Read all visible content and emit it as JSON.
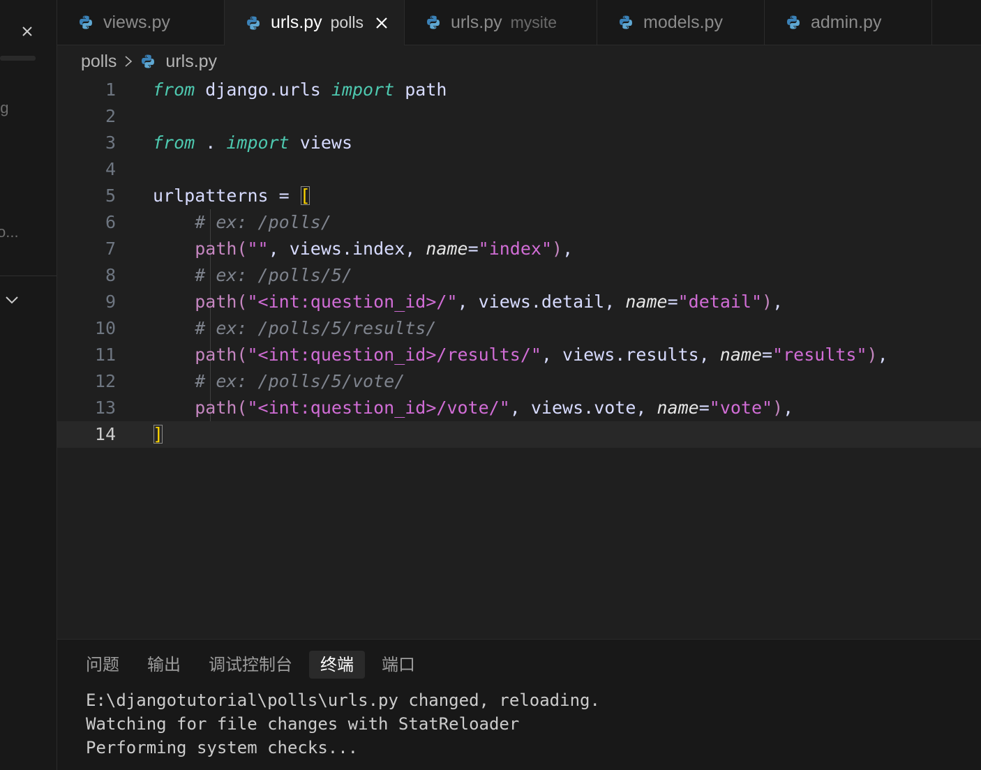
{
  "side_panel": {
    "fragment_1": "ng",
    "fragment_2": "o..."
  },
  "tabs": [
    {
      "label": "views.py",
      "description": "",
      "active": false
    },
    {
      "label": "urls.py",
      "description": "polls",
      "active": true
    },
    {
      "label": "urls.py",
      "description": "mysite",
      "active": false
    },
    {
      "label": "models.py",
      "description": "",
      "active": false
    },
    {
      "label": "admin.py",
      "description": "",
      "active": false
    }
  ],
  "breadcrumb": {
    "folder": "polls",
    "file": "urls.py"
  },
  "editor": {
    "current_line": 14,
    "line_numbers": [
      "1",
      "2",
      "3",
      "4",
      "5",
      "6",
      "7",
      "8",
      "9",
      "10",
      "11",
      "12",
      "13",
      "14"
    ],
    "lines": [
      [
        {
          "t": "from",
          "c": "kw"
        },
        {
          "t": " django.urls ",
          "c": "def"
        },
        {
          "t": "import",
          "c": "kw"
        },
        {
          "t": " path",
          "c": "def"
        }
      ],
      [],
      [
        {
          "t": "from",
          "c": "kw"
        },
        {
          "t": " . ",
          "c": "def"
        },
        {
          "t": "import",
          "c": "kw"
        },
        {
          "t": " views",
          "c": "def"
        }
      ],
      [],
      [
        {
          "t": "urlpatterns = ",
          "c": "def"
        },
        {
          "t": "[",
          "c": "br"
        }
      ],
      [
        {
          "t": "    "
        },
        {
          "t": "# ex: /polls/",
          "c": "cm"
        }
      ],
      [
        {
          "t": "    "
        },
        {
          "t": "path(",
          "c": "pw"
        },
        {
          "t": "\"\"",
          "c": "st"
        },
        {
          "t": ", views.index, ",
          "c": "def"
        },
        {
          "t": "name",
          "c": "pm"
        },
        {
          "t": "=",
          "c": "def"
        },
        {
          "t": "\"index\"",
          "c": "st"
        },
        {
          "t": ")",
          "c": "pw"
        },
        {
          "t": ",",
          "c": "def"
        }
      ],
      [
        {
          "t": "    "
        },
        {
          "t": "# ex: /polls/5/",
          "c": "cm"
        }
      ],
      [
        {
          "t": "    "
        },
        {
          "t": "path(",
          "c": "pw"
        },
        {
          "t": "\"<int:question_id>/\"",
          "c": "st"
        },
        {
          "t": ", views.detail, ",
          "c": "def"
        },
        {
          "t": "name",
          "c": "pm"
        },
        {
          "t": "=",
          "c": "def"
        },
        {
          "t": "\"detail\"",
          "c": "st"
        },
        {
          "t": ")",
          "c": "pw"
        },
        {
          "t": ",",
          "c": "def"
        }
      ],
      [
        {
          "t": "    "
        },
        {
          "t": "# ex: /polls/5/results/",
          "c": "cm"
        }
      ],
      [
        {
          "t": "    "
        },
        {
          "t": "path(",
          "c": "pw"
        },
        {
          "t": "\"<int:question_id>/results/\"",
          "c": "st"
        },
        {
          "t": ", views.results, ",
          "c": "def"
        },
        {
          "t": "name",
          "c": "pm"
        },
        {
          "t": "=",
          "c": "def"
        },
        {
          "t": "\"results\"",
          "c": "st"
        },
        {
          "t": ")",
          "c": "pw"
        },
        {
          "t": ",",
          "c": "def"
        }
      ],
      [
        {
          "t": "    "
        },
        {
          "t": "# ex: /polls/5/vote/",
          "c": "cm"
        }
      ],
      [
        {
          "t": "    "
        },
        {
          "t": "path(",
          "c": "pw"
        },
        {
          "t": "\"<int:question_id>/vote/\"",
          "c": "st"
        },
        {
          "t": ", views.vote, ",
          "c": "def"
        },
        {
          "t": "name",
          "c": "pm"
        },
        {
          "t": "=",
          "c": "def"
        },
        {
          "t": "\"vote\"",
          "c": "st"
        },
        {
          "t": ")",
          "c": "pw"
        },
        {
          "t": ",",
          "c": "def"
        }
      ],
      [
        {
          "t": "]",
          "c": "br"
        }
      ]
    ]
  },
  "panel": {
    "tabs": [
      "问题",
      "输出",
      "调试控制台",
      "终端",
      "端口"
    ],
    "active_tab": "终端",
    "terminal_lines": [
      "E:\\djangotutorial\\polls\\urls.py changed, reloading.",
      "Watching for file changes with StatReloader",
      "Performing system checks..."
    ]
  },
  "icons": {
    "file_icon": "python-icon",
    "close": "close-icon",
    "breadcrumb_sep": "chevron-right-icon"
  },
  "colors": {
    "python_icon_blue": "#3b82b8",
    "python_icon_yellow": "#5fa8d3",
    "keyword": "#4ec9b0",
    "string": "#d16dd6",
    "comment": "#7f848e",
    "bracket": "#ffd700"
  }
}
